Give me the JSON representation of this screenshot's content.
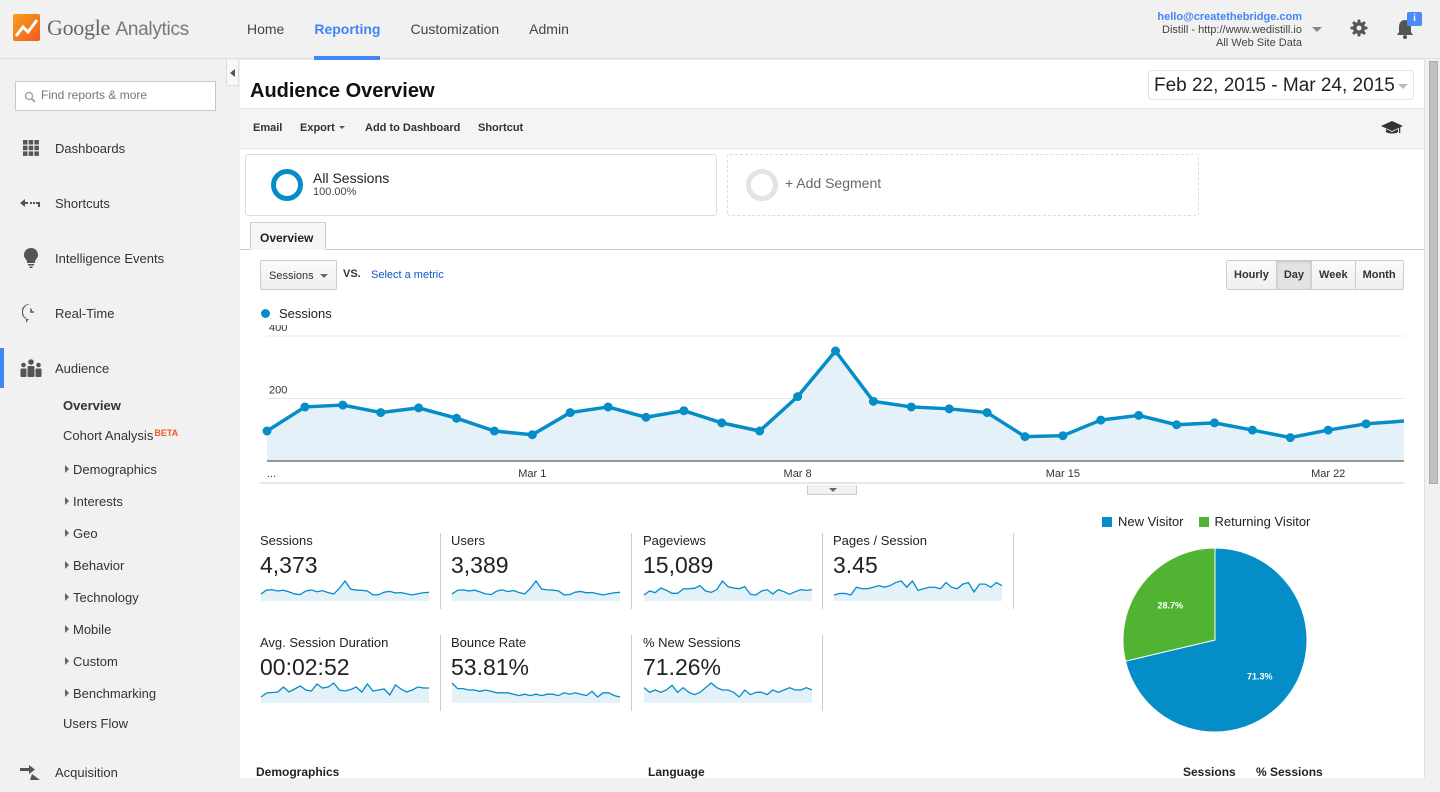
{
  "app": {
    "name_google": "Google",
    "name_analytics": "Analytics"
  },
  "nav": {
    "tabs": [
      {
        "label": "Home",
        "active": false
      },
      {
        "label": "Reporting",
        "active": true
      },
      {
        "label": "Customization",
        "active": false
      },
      {
        "label": "Admin",
        "active": false
      }
    ]
  },
  "account": {
    "email": "hello@createthebridge.com",
    "property": "Distill - http://www.wedistill.io",
    "view": "All Web Site Data",
    "notification_badge": "i"
  },
  "sidebar": {
    "search_placeholder": "Find reports & more",
    "items": [
      {
        "label": "Dashboards",
        "icon": "grid-icon"
      },
      {
        "label": "Shortcuts",
        "icon": "shortcut-arrow-icon"
      },
      {
        "label": "Intelligence Events",
        "icon": "lightbulb-icon"
      },
      {
        "label": "Real-Time",
        "icon": "clock-icon"
      },
      {
        "label": "Audience",
        "icon": "people-icon",
        "active": true
      }
    ],
    "audience_sub": [
      {
        "label": "Overview",
        "bold": true
      },
      {
        "label": "Cohort Analysis",
        "badge": "BETA"
      },
      {
        "label": "Demographics",
        "expandable": true
      },
      {
        "label": "Interests",
        "expandable": true
      },
      {
        "label": "Geo",
        "expandable": true
      },
      {
        "label": "Behavior",
        "expandable": true
      },
      {
        "label": "Technology",
        "expandable": true
      },
      {
        "label": "Mobile",
        "expandable": true
      },
      {
        "label": "Custom",
        "expandable": true
      },
      {
        "label": "Benchmarking",
        "expandable": true
      },
      {
        "label": "Users Flow"
      }
    ],
    "acquisition": {
      "label": "Acquisition",
      "icon": "acquisition-icon"
    }
  },
  "main": {
    "title": "Audience Overview",
    "date_range": "Feb 22, 2015 - Mar 24, 2015",
    "toolbar": {
      "email": "Email",
      "export": "Export",
      "add_dashboard": "Add to Dashboard",
      "shortcut": "Shortcut"
    },
    "segments": [
      {
        "name": "All Sessions",
        "pct": "100.00%"
      },
      {
        "name": "+ Add Segment"
      }
    ],
    "tab": "Overview",
    "metric_select": "Sessions",
    "vs_label": "VS.",
    "select_metric": "Select a metric",
    "granularity": [
      {
        "label": "Hourly",
        "active": false
      },
      {
        "label": "Day",
        "active": true
      },
      {
        "label": "Week",
        "active": false
      },
      {
        "label": "Month",
        "active": false
      }
    ],
    "tiles": [
      {
        "label": "Sessions",
        "value": "4,373",
        "spark": [
          96,
          173,
          179,
          155,
          170,
          137,
          96,
          84,
          155,
          173,
          140,
          161,
          122,
          96,
          206,
          352,
          191,
          173,
          167,
          155,
          78,
          81,
          131,
          146,
          116,
          122,
          99,
          75,
          99,
          119,
          128
        ]
      },
      {
        "label": "Users",
        "value": "3,389",
        "spark": [
          80,
          140,
          145,
          128,
          140,
          112,
          80,
          70,
          128,
          145,
          118,
          135,
          100,
          80,
          170,
          290,
          160,
          145,
          140,
          130,
          65,
          68,
          108,
          120,
          98,
          102,
          82,
          62,
          82,
          98,
          106
        ]
      },
      {
        "label": "Pageviews",
        "value": "15,089",
        "spark": [
          400,
          520,
          470,
          610,
          540,
          450,
          450,
          580,
          590,
          600,
          680,
          520,
          480,
          560,
          820,
          650,
          610,
          590,
          650,
          420,
          400,
          520,
          560,
          430,
          560,
          500,
          420,
          500,
          560,
          540,
          560
        ]
      },
      {
        "label": "Pages / Session",
        "value": "3.45",
        "spark": [
          2.8,
          2.9,
          2.9,
          2.8,
          3.3,
          3.2,
          3.2,
          3.3,
          3.4,
          3.3,
          3.4,
          3.6,
          3.7,
          3.3,
          3.7,
          3.1,
          3.2,
          3.3,
          3.3,
          3.2,
          3.6,
          3.3,
          3.2,
          3.5,
          3.6,
          3.0,
          3.5,
          3.5,
          3.3,
          3.6,
          3.4
        ]
      },
      {
        "label": "Avg. Session Duration",
        "value": "00:02:52",
        "spark": [
          100,
          140,
          145,
          150,
          200,
          150,
          180,
          210,
          170,
          160,
          230,
          190,
          200,
          240,
          170,
          160,
          175,
          200,
          150,
          230,
          160,
          170,
          180,
          120,
          220,
          180,
          150,
          170,
          200,
          190,
          190
        ]
      },
      {
        "label": "Bounce Rate",
        "value": "53.81%",
        "spark": [
          62,
          58,
          58,
          57,
          57,
          56,
          57,
          56,
          55,
          55,
          55,
          54,
          53,
          54,
          53,
          54,
          53,
          54,
          54,
          53,
          55,
          54,
          55,
          54,
          53,
          56,
          52,
          55,
          55,
          53,
          52
        ]
      },
      {
        "label": "% New Sessions",
        "value": "71.26%",
        "spark": [
          72,
          70,
          71,
          70,
          71,
          73,
          70,
          72,
          70,
          69,
          70,
          72,
          74,
          72,
          71,
          71,
          70,
          68,
          71,
          69,
          70,
          70,
          69,
          71,
          70,
          71,
          72,
          71,
          71,
          72,
          71
        ]
      }
    ],
    "pie": {
      "legend": [
        {
          "label": "New Visitor",
          "color": "#058dc7"
        },
        {
          "label": "Returning Visitor",
          "color": "#50b432"
        }
      ]
    },
    "bottom": {
      "demographics": "Demographics",
      "language": "Language",
      "sessions": "Sessions",
      "pct_sessions": "% Sessions"
    }
  },
  "chart_data": [
    {
      "type": "area",
      "title": "Sessions",
      "series": [
        {
          "name": "Sessions",
          "color": "#058dc7",
          "values": [
            96,
            173,
            179,
            155,
            170,
            137,
            96,
            84,
            155,
            173,
            140,
            161,
            122,
            96,
            206,
            352,
            191,
            173,
            167,
            155,
            78,
            81,
            131,
            146,
            116,
            122,
            99,
            75,
            99,
            119,
            128
          ]
        }
      ],
      "x_start": "Feb 22, 2015",
      "x_ticks": [
        {
          "index": 0,
          "label": "..."
        },
        {
          "index": 7,
          "label": "Mar 1"
        },
        {
          "index": 14,
          "label": "Mar 8"
        },
        {
          "index": 21,
          "label": "Mar 15"
        },
        {
          "index": 28,
          "label": "Mar 22"
        }
      ],
      "y_ticks": [
        200,
        400
      ],
      "ylim": [
        0,
        400
      ],
      "grid": true,
      "legend": "top-left"
    },
    {
      "type": "pie",
      "labels": [
        "New Visitor",
        "Returning Visitor"
      ],
      "values": [
        71.3,
        28.7
      ],
      "value_labels": [
        "71.3%",
        "28.7%"
      ],
      "colors": [
        "#058dc7",
        "#50b432"
      ],
      "legend": "top"
    }
  ]
}
